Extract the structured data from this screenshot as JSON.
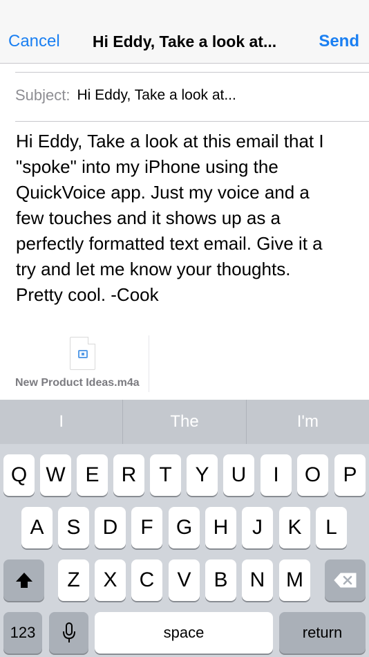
{
  "nav": {
    "cancel_label": "Cancel",
    "title": "Hi Eddy, Take a look at...",
    "send_label": "Send"
  },
  "subject": {
    "label": "Subject:",
    "value": "Hi Eddy, Take a look at..."
  },
  "body_lines": [
    "Hi Eddy, Take a look at this email that I",
    "\"spoke\" into my iPhone using the",
    "QuickVoice app. Just my voice and a",
    "few touches and it shows up as a",
    "perfectly formatted text email. Give it a",
    "try and let me know your thoughts.",
    "Pretty cool. -Cook"
  ],
  "attachment": {
    "icon": "audio-file-icon",
    "name": "New Product Ideas.m4a"
  },
  "keyboard": {
    "predictions": [
      "I",
      "The",
      "I'm"
    ],
    "row1": [
      "Q",
      "W",
      "E",
      "R",
      "T",
      "Y",
      "U",
      "I",
      "O",
      "P"
    ],
    "row2": [
      "A",
      "S",
      "D",
      "F",
      "G",
      "H",
      "J",
      "K",
      "L"
    ],
    "row3": [
      "Z",
      "X",
      "C",
      "V",
      "B",
      "N",
      "M"
    ],
    "numbers_label": "123",
    "space_label": "space",
    "return_label": "return",
    "shift_icon": "shift-arrow-icon",
    "delete_icon": "backspace-icon",
    "mic_icon": "microphone-icon"
  },
  "colors": {
    "accent": "#1a7ff2",
    "keyboard_bg": "#d1d5db"
  }
}
